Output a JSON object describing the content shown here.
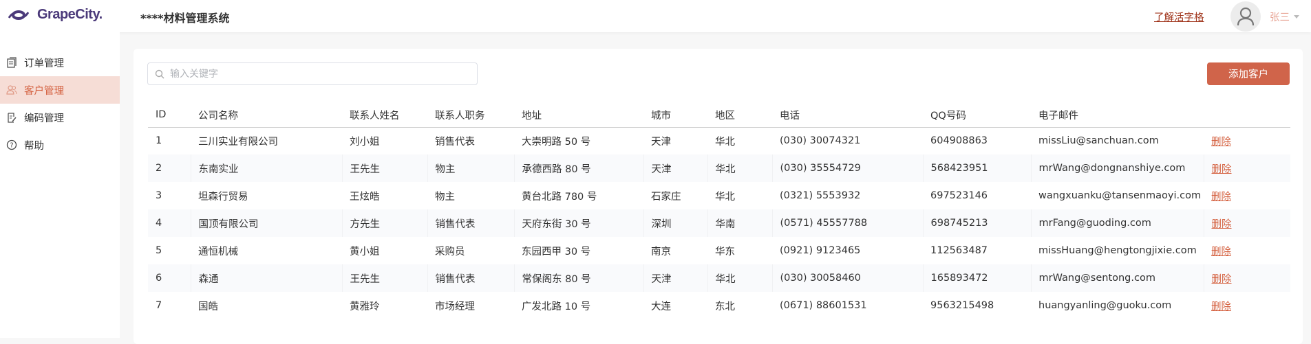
{
  "header": {
    "logo": "GrapeCity.",
    "title": "****材料管理系统",
    "learn_link": "了解活字格",
    "user_name": "张三"
  },
  "sidebar": {
    "items": [
      {
        "label": "订单管理",
        "icon": "document-icon"
      },
      {
        "label": "客户管理",
        "icon": "users-icon",
        "active": true
      },
      {
        "label": "编码管理",
        "icon": "edit-document-icon"
      },
      {
        "label": "帮助",
        "icon": "help-icon"
      }
    ]
  },
  "toolbar": {
    "search_placeholder": "输入关键字",
    "search_value": "",
    "add_label": "添加客户"
  },
  "table": {
    "columns": [
      "ID",
      "公司名称",
      "联系人姓名",
      "联系人职务",
      "地址",
      "城市",
      "地区",
      "电话",
      "QQ号码",
      "电子邮件",
      ""
    ],
    "rows": [
      [
        "1",
        "三川实业有限公司",
        "刘小姐",
        "销售代表",
        "大崇明路 50 号",
        "天津",
        "华北",
        "(030) 30074321",
        "604908863",
        "missLiu@sanchuan.com",
        "删除"
      ],
      [
        "2",
        "东南实业",
        "王先生",
        "物主",
        "承德西路 80 号",
        "天津",
        "华北",
        "(030) 35554729",
        "568423951",
        "mrWang@dongnanshiye.com",
        "删除"
      ],
      [
        "3",
        "坦森行贸易",
        "王炫皓",
        "物主",
        "黄台北路 780 号",
        "石家庄",
        "华北",
        "(0321) 5553932",
        "697523146",
        "wangxuanku@tansenmaoyi.com",
        "删除"
      ],
      [
        "4",
        "国顶有限公司",
        "方先生",
        "销售代表",
        "天府东街 30 号",
        "深圳",
        "华南",
        "(0571) 45557788",
        "698745213",
        "mrFang@guoding.com",
        "删除"
      ],
      [
        "5",
        "通恒机械",
        "黄小姐",
        "采购员",
        "东园西甲 30 号",
        "南京",
        "华东",
        "(0921) 9123465",
        "112563487",
        "missHuang@hengtongjixie.com",
        "删除"
      ],
      [
        "6",
        "森通",
        "王先生",
        "销售代表",
        "常保阁东 80 号",
        "天津",
        "华北",
        "(030) 30058460",
        "165893472",
        "mrWang@sentong.com",
        "删除"
      ],
      [
        "7",
        "国皓",
        "黄雅玲",
        "市场经理",
        "广发北路 10 号",
        "大连",
        "东北",
        "(0671) 88601531",
        "9563215498",
        "huangyanling@guoku.com",
        "删除"
      ]
    ]
  },
  "colors": {
    "accent": "#d0644a",
    "active_bg": "#f6ddd6",
    "link": "#a0351c",
    "brand": "#4b3a7a"
  }
}
